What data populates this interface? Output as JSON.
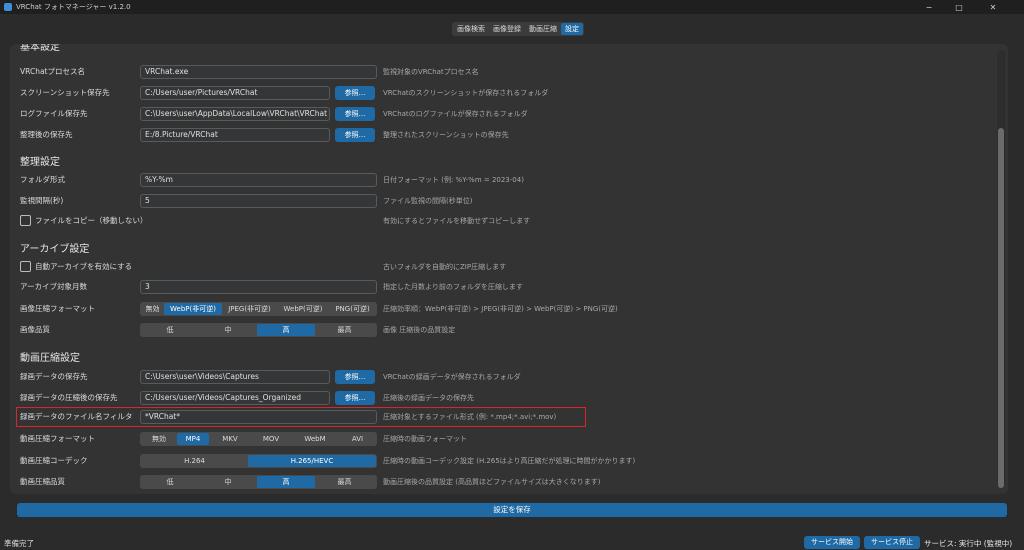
{
  "window": {
    "title": "VRChat フォトマネージャー v1.2.0",
    "minimize": "−",
    "maximize": "□",
    "close": "✕"
  },
  "tabs": [
    {
      "label": "画像検索",
      "active": false
    },
    {
      "label": "画像登録",
      "active": false
    },
    {
      "label": "動画圧縮",
      "active": false
    },
    {
      "label": "設定",
      "active": true
    }
  ],
  "basic": {
    "header": "基本設定",
    "process": {
      "label": "VRChatプロセス名",
      "value": "VRChat.exe",
      "desc": "監視対象のVRChatプロセス名"
    },
    "screenshot_dir": {
      "label": "スクリーンショット保存先",
      "value": "C:/Users/user/Pictures/VRChat",
      "browse": "参照...",
      "desc": "VRChatのスクリーンショットが保存されるフォルダ"
    },
    "log_dir": {
      "label": "ログファイル保存先",
      "value": "C:\\Users\\user\\AppData\\LocalLow\\VRChat\\VRChat",
      "browse": "参照...",
      "desc": "VRChatのログファイルが保存されるフォルダ"
    },
    "organized_dir": {
      "label": "整理後の保存先",
      "value": "E:/8.Picture/VRChat",
      "browse": "参照...",
      "desc": "整理されたスクリーンショットの保存先"
    }
  },
  "organize": {
    "header": "整理設定",
    "folder_format": {
      "label": "フォルダ形式",
      "value": "%Y-%m",
      "desc": "日付フォーマット (例: %Y-%m = 2023-04)"
    },
    "interval": {
      "label": "監視間隔(秒)",
      "value": "5",
      "desc": "ファイル監視の間隔(秒単位)"
    },
    "copy_files": {
      "label": "ファイルをコピー（移動しない）",
      "checked": false,
      "desc": "有効にするとファイルを移動せずコピーします"
    }
  },
  "archive": {
    "header": "アーカイブ設定",
    "auto_archive": {
      "label": "自動アーカイブを有効にする",
      "checked": false,
      "desc": "古いフォルダを自動的にZIP圧縮します"
    },
    "months": {
      "label": "アーカイブ対象月数",
      "value": "3",
      "desc": "指定した月数より前のフォルダを圧縮します"
    },
    "image_format": {
      "label": "画像圧縮フォーマット",
      "options": [
        "無効",
        "WebP(非可逆)",
        "JPEG(非可逆)",
        "WebP(可逆)",
        "PNG(可逆)"
      ],
      "selected": "WebP(非可逆)",
      "desc": "圧縮効率順：WebP(非可逆) > JPEG(非可逆) > WebP(可逆) > PNG(可逆)"
    },
    "image_quality": {
      "label": "画像品質",
      "options": [
        "低",
        "中",
        "高",
        "最高"
      ],
      "selected": "高",
      "desc": "画像 圧縮後の品質設定"
    }
  },
  "video": {
    "header": "動画圧縮設定",
    "video_dir": {
      "label": "録画データの保存先",
      "value": "C:\\Users\\user\\Videos\\Captures",
      "browse": "参照...",
      "desc": "VRChatの録画データが保存されるフォルダ"
    },
    "compressed_dir": {
      "label": "録画データの圧縮後の保存先",
      "value": "C:/Users/user/Videos/Captures_Organized",
      "browse": "参照...",
      "desc": "圧縮後の録画データの保存先"
    },
    "name_filter": {
      "label": "録画データのファイル名フィルタ",
      "value": "*VRChat*",
      "desc": "圧縮対象とするファイル形式 (例: *.mp4;*.avi;*.mov)"
    },
    "format": {
      "label": "動画圧縮フォーマット",
      "options": [
        "無効",
        "MP4",
        "MKV",
        "MOV",
        "WebM",
        "AVI"
      ],
      "selected": "MP4",
      "desc": "圧縮時の動画フォーマット"
    },
    "codec": {
      "label": "動画圧縮コーデック",
      "options": [
        "H.264",
        "H.265/HEVC"
      ],
      "selected": "H.265/HEVC",
      "desc": "圧縮時の動画コーデック設定 (H.265はより高圧縮だが処理に時間がかかります)"
    },
    "quality": {
      "label": "動画圧縮品質",
      "options": [
        "低",
        "中",
        "高",
        "最高"
      ],
      "selected": "高",
      "desc": "動画圧縮後の品質設定 (高品質ほどファイルサイズは大きくなります)"
    }
  },
  "save_button": "設定を保存",
  "status": {
    "text": "準備完了",
    "start_button": "サービス開始",
    "stop_button": "サービス停止",
    "service_status": "サービス: 実行中 (監視中)"
  },
  "colors": {
    "accent": "#1f6aa5",
    "highlight": "#d9262c"
  }
}
